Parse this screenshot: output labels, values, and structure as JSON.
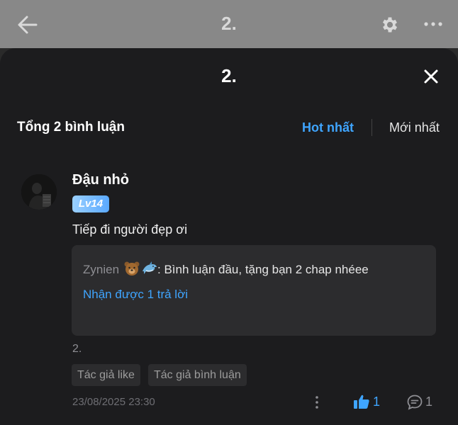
{
  "header": {
    "title": "2."
  },
  "sheet": {
    "title": "2.",
    "comment_count_label": "Tổng 2 bình luận",
    "sort": {
      "hot_label": "Hot nhất",
      "new_label": "Mới nhất",
      "active": "Hot nhất"
    }
  },
  "comment": {
    "username": "Đậu nhỏ",
    "level": "Lv14",
    "text": "Tiếp đi người đẹp ơi",
    "reply": {
      "author": "Zynien",
      "author_emojis": [
        "bear-icon",
        "dolphin-icon"
      ],
      "text": ": Bình luận đầu, tặng bạn 2 chap nhéee",
      "link": "Nhận được 1 trả lời"
    },
    "chapter": "2.",
    "tags": [
      "Tác giả like",
      "Tác giả bình luận"
    ],
    "date": "23/08/2025 23:30",
    "likes": "1",
    "replies": "1"
  },
  "colors": {
    "accent": "#3fa5ff",
    "sheet_bg": "#1c1c1e",
    "card_bg": "#2c2c2e",
    "topbar_bg": "#888888"
  }
}
